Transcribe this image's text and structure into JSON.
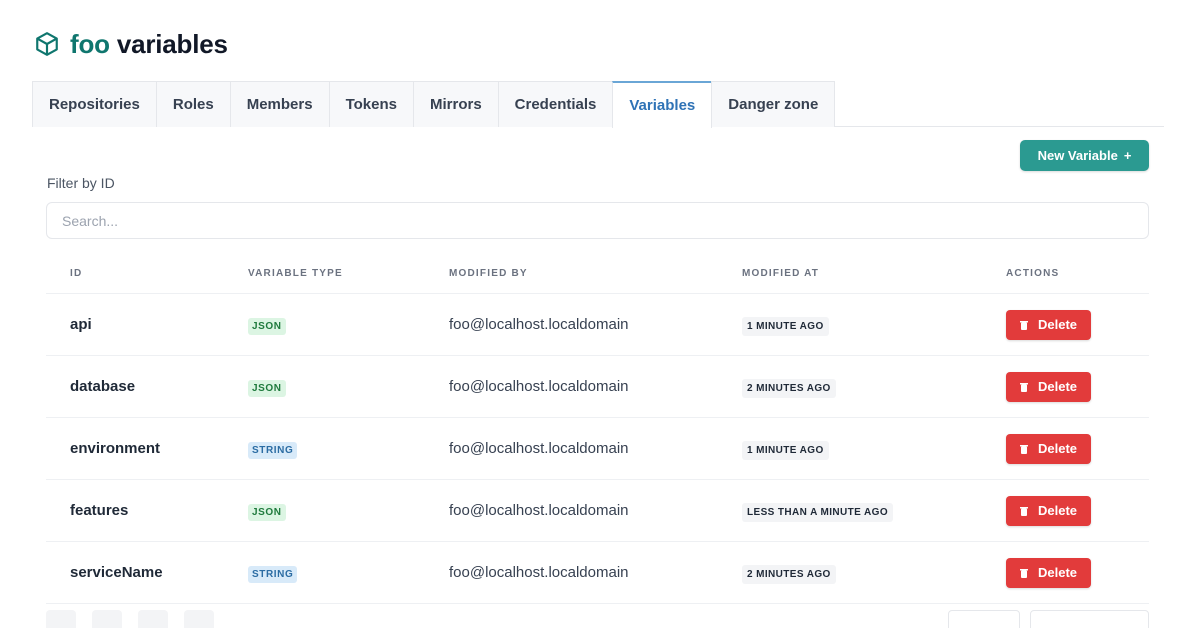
{
  "header": {
    "org": "foo",
    "title": "variables",
    "icon": "cube-icon"
  },
  "tabs": [
    {
      "label": "Repositories",
      "active": false
    },
    {
      "label": "Roles",
      "active": false
    },
    {
      "label": "Members",
      "active": false
    },
    {
      "label": "Tokens",
      "active": false
    },
    {
      "label": "Mirrors",
      "active": false
    },
    {
      "label": "Credentials",
      "active": false
    },
    {
      "label": "Variables",
      "active": true
    },
    {
      "label": "Danger zone",
      "active": false
    }
  ],
  "toolbar": {
    "new_label": "New Variable",
    "new_icon": "+"
  },
  "filter": {
    "label": "Filter by ID",
    "placeholder": "Search..."
  },
  "table": {
    "headers": {
      "id": "ID",
      "type": "VARIABLE TYPE",
      "by": "MODIFIED BY",
      "at": "MODIFIED AT",
      "actions": "ACTIONS"
    },
    "rows": [
      {
        "id": "api",
        "type": "JSON",
        "by": "foo@localhost.localdomain",
        "at": "1 MINUTE AGO",
        "action": "Delete"
      },
      {
        "id": "database",
        "type": "JSON",
        "by": "foo@localhost.localdomain",
        "at": "2 MINUTES AGO",
        "action": "Delete"
      },
      {
        "id": "environment",
        "type": "STRING",
        "by": "foo@localhost.localdomain",
        "at": "1 MINUTE AGO",
        "action": "Delete"
      },
      {
        "id": "features",
        "type": "JSON",
        "by": "foo@localhost.localdomain",
        "at": "LESS THAN A MINUTE AGO",
        "action": "Delete"
      },
      {
        "id": "serviceName",
        "type": "STRING",
        "by": "foo@localhost.localdomain",
        "at": "2 MINUTES AGO",
        "action": "Delete"
      }
    ]
  },
  "colors": {
    "accent": "#2b9a91",
    "danger": "#e23b3b",
    "active_tab": "#2f73b6"
  }
}
